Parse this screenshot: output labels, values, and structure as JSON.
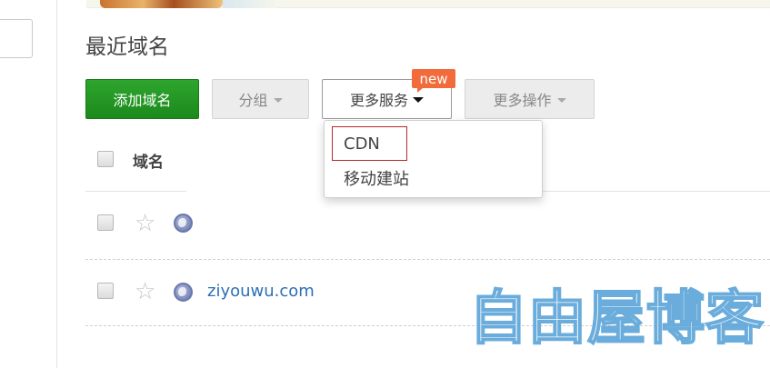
{
  "page": {
    "title": "最近域名"
  },
  "toolbar": {
    "add_domain_label": "添加域名",
    "group_label": "分组",
    "more_services_label": "更多服务",
    "more_actions_label": "更多操作",
    "new_badge": "new"
  },
  "dropdown": {
    "items": [
      {
        "label": "CDN",
        "highlighted": true
      },
      {
        "label": "移动建站",
        "highlighted": false
      }
    ]
  },
  "table": {
    "header": {
      "domain_column": "域名"
    },
    "rows": [
      {
        "domain": "",
        "starred": false
      },
      {
        "domain": "ziyouwu.com",
        "starred": false
      }
    ]
  },
  "watermark": {
    "text": "自由屋博客"
  },
  "colors": {
    "primary_green": "#1e941e",
    "new_badge": "#f26b3a",
    "link_blue": "#2d6fb5",
    "highlight_red": "#b7282e",
    "watermark_blue": "#5aa4d8"
  },
  "icons": {
    "star": "star-outline-icon",
    "globe": "globe-icon",
    "caret": "caret-down-icon"
  }
}
